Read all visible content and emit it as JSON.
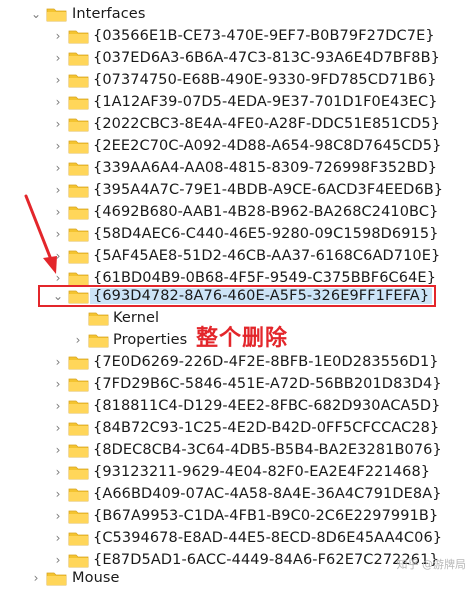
{
  "root": {
    "label": "Interfaces"
  },
  "items": [
    {
      "label": "{03566E1B-CE73-470E-9EF7-B0B79F27DC7E}"
    },
    {
      "label": "{037ED6A3-6B6A-47C3-813C-93A6E4D7BF8B}"
    },
    {
      "label": "{07374750-E68B-490E-9330-9FD785CD71B6}"
    },
    {
      "label": "{1A12AF39-07D5-4EDA-9E37-701D1F0E43EC}"
    },
    {
      "label": "{2022CBC3-8E4A-4FE0-A28F-DDC51E851CD5}"
    },
    {
      "label": "{2EE2C70C-A092-4D88-A654-98C8D7645CD5}"
    },
    {
      "label": "{339AA6A4-AA08-4815-8309-726998F352BD}"
    },
    {
      "label": "{395A4A7C-79E1-4BDB-A9CE-6ACD3F4EED6B}"
    },
    {
      "label": "{4692B680-AAB1-4B28-B962-BA268C2410BC}"
    },
    {
      "label": "{58D4AEC6-C440-46E5-9280-09C1598D6915}"
    },
    {
      "label": "{5AF45AE8-51D2-46CB-AA37-6168C6AD710E}"
    },
    {
      "label": "{61BD04B9-0B68-4F5F-9549-C375BBF6C64E}"
    },
    {
      "label": "{693D4782-8A76-460E-A5F5-326E9FF1FEFA}"
    },
    {
      "label": "Kernel"
    },
    {
      "label": "Properties"
    },
    {
      "label": "{7E0D6269-226D-4F2E-8BFB-1E0D283556D1}"
    },
    {
      "label": "{7FD29B6C-5846-451E-A72D-56BB201D83D4}"
    },
    {
      "label": "{818811C4-D129-4EE2-8FBC-682D930ACA5D}"
    },
    {
      "label": "{84B72C93-1C25-4E2D-B42D-0FF5CFCCAC28}"
    },
    {
      "label": "{8DEC8CB4-3C64-4DB5-B5B4-BA2E3281B076}"
    },
    {
      "label": "{93123211-9629-4E04-82F0-EA2E4F221468}"
    },
    {
      "label": "{A66BD409-07AC-4A58-8A4E-36A4C791DE8A}"
    },
    {
      "label": "{B67A9953-C1DA-4FB1-B9C0-2C6E2297991B}"
    },
    {
      "label": "{C5394678-E8AD-44E5-8ECD-8D6E45AA4C06}"
    },
    {
      "label": "{E87D5AD1-6ACC-4449-84A6-F62E7C272261}"
    },
    {
      "label": "Mouse"
    }
  ],
  "annotation": "整个删除",
  "watermark": "知乎 @游牌局",
  "colors": {
    "folder": "#f4c430",
    "selection": "#cce4f7",
    "highlight": "#e3262b"
  }
}
